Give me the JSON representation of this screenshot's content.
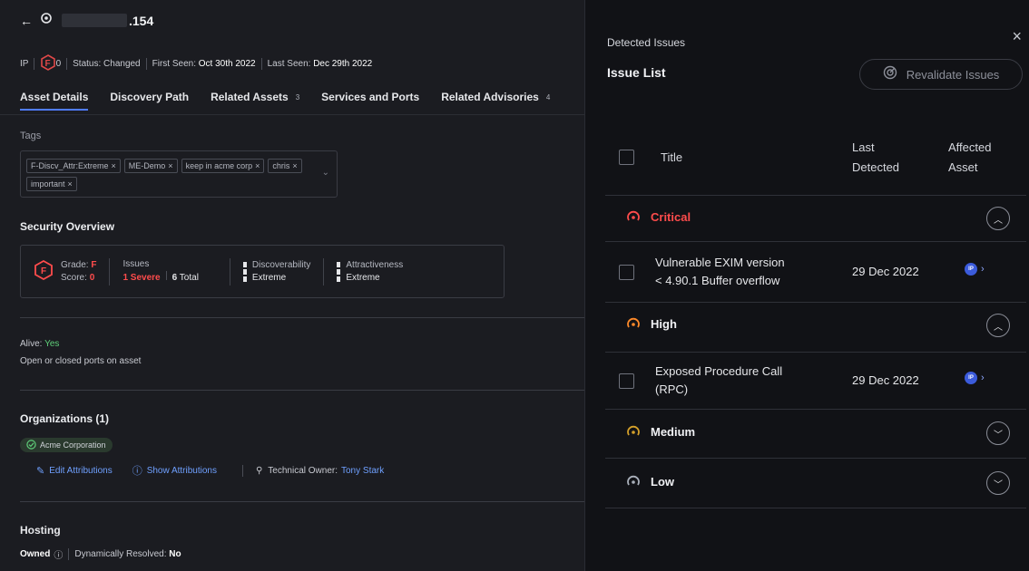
{
  "header": {
    "back_icon": "arrow-left-icon",
    "asset_type_icon": "location-pin-icon",
    "asset_suffix": ".154"
  },
  "meta": {
    "type": "IP",
    "grade_letter": "F",
    "grade_value": "0",
    "status": "Status: Changed",
    "first_seen_label": "First Seen:",
    "first_seen": "Oct 30th 2022",
    "last_seen_label": "Last Seen:",
    "last_seen": "Dec 29th 2022"
  },
  "tabs": [
    {
      "label": "Asset Details",
      "count": ""
    },
    {
      "label": "Discovery Path",
      "count": ""
    },
    {
      "label": "Related Assets",
      "count": "3"
    },
    {
      "label": "Services and Ports",
      "count": ""
    },
    {
      "label": "Related Advisories",
      "count": "4"
    }
  ],
  "tags": {
    "label": "Tags",
    "items": [
      "F-Discv_Attr:Extreme",
      "ME-Demo",
      "keep in acme corp",
      "chris",
      "important"
    ],
    "remove_glyph": "×"
  },
  "security": {
    "title": "Security Overview",
    "grade_label": "Grade:",
    "grade": "F",
    "score_label": "Score:",
    "score": "0",
    "issues_label": "Issues",
    "severe": "1 Severe",
    "total_num": "6",
    "total_label": "Total",
    "discoverability_label": "Discoverability",
    "discoverability": "Extreme",
    "attractiveness_label": "Attractiveness",
    "attractiveness": "Extreme"
  },
  "status": {
    "alive_label": "Alive:",
    "alive": "Yes",
    "ports_text": "Open or closed ports on asset"
  },
  "organizations": {
    "title": "Organizations (1)",
    "chip": "Acme Corporation",
    "edit": "Edit Attributions",
    "show": "Show Attributions",
    "owner_label": "Technical Owner:",
    "owner": "Tony Stark"
  },
  "hosting": {
    "title": "Hosting",
    "owned": "Owned",
    "dyn_label": "Dynamically Resolved:",
    "dyn_value": "No"
  },
  "panel": {
    "detected": "Detected Issues",
    "close_glyph": "×",
    "list_title": "Issue List",
    "revalidate": "Revalidate Issues",
    "col_title": "Title",
    "col_last1": "Last",
    "col_last2": "Detected",
    "col_aff1": "Affected",
    "col_aff2": "Asset",
    "severities": [
      {
        "label": "Critical",
        "color": "#ff4c4c",
        "expanded": true
      },
      {
        "label": "High",
        "color": "#ff8a2a",
        "expanded": true
      },
      {
        "label": "Medium",
        "color": "#d4a02a",
        "expanded": false
      },
      {
        "label": "Low",
        "color": "#aab0bb",
        "expanded": false
      }
    ],
    "issues": [
      {
        "title1": "Vulnerable EXIM version",
        "title2": "< 4.90.1 Buffer overflow",
        "date": "29 Dec 2022",
        "asset_badge": "IP"
      },
      {
        "title1": "Exposed Procedure Call",
        "title2": "(RPC)",
        "date": "29 Dec 2022",
        "asset_badge": "IP"
      }
    ]
  },
  "colors": {
    "accent": "#4f7cff",
    "link": "#6fa0ff",
    "danger": "#ff4c4c",
    "success": "#5fcf7a"
  }
}
